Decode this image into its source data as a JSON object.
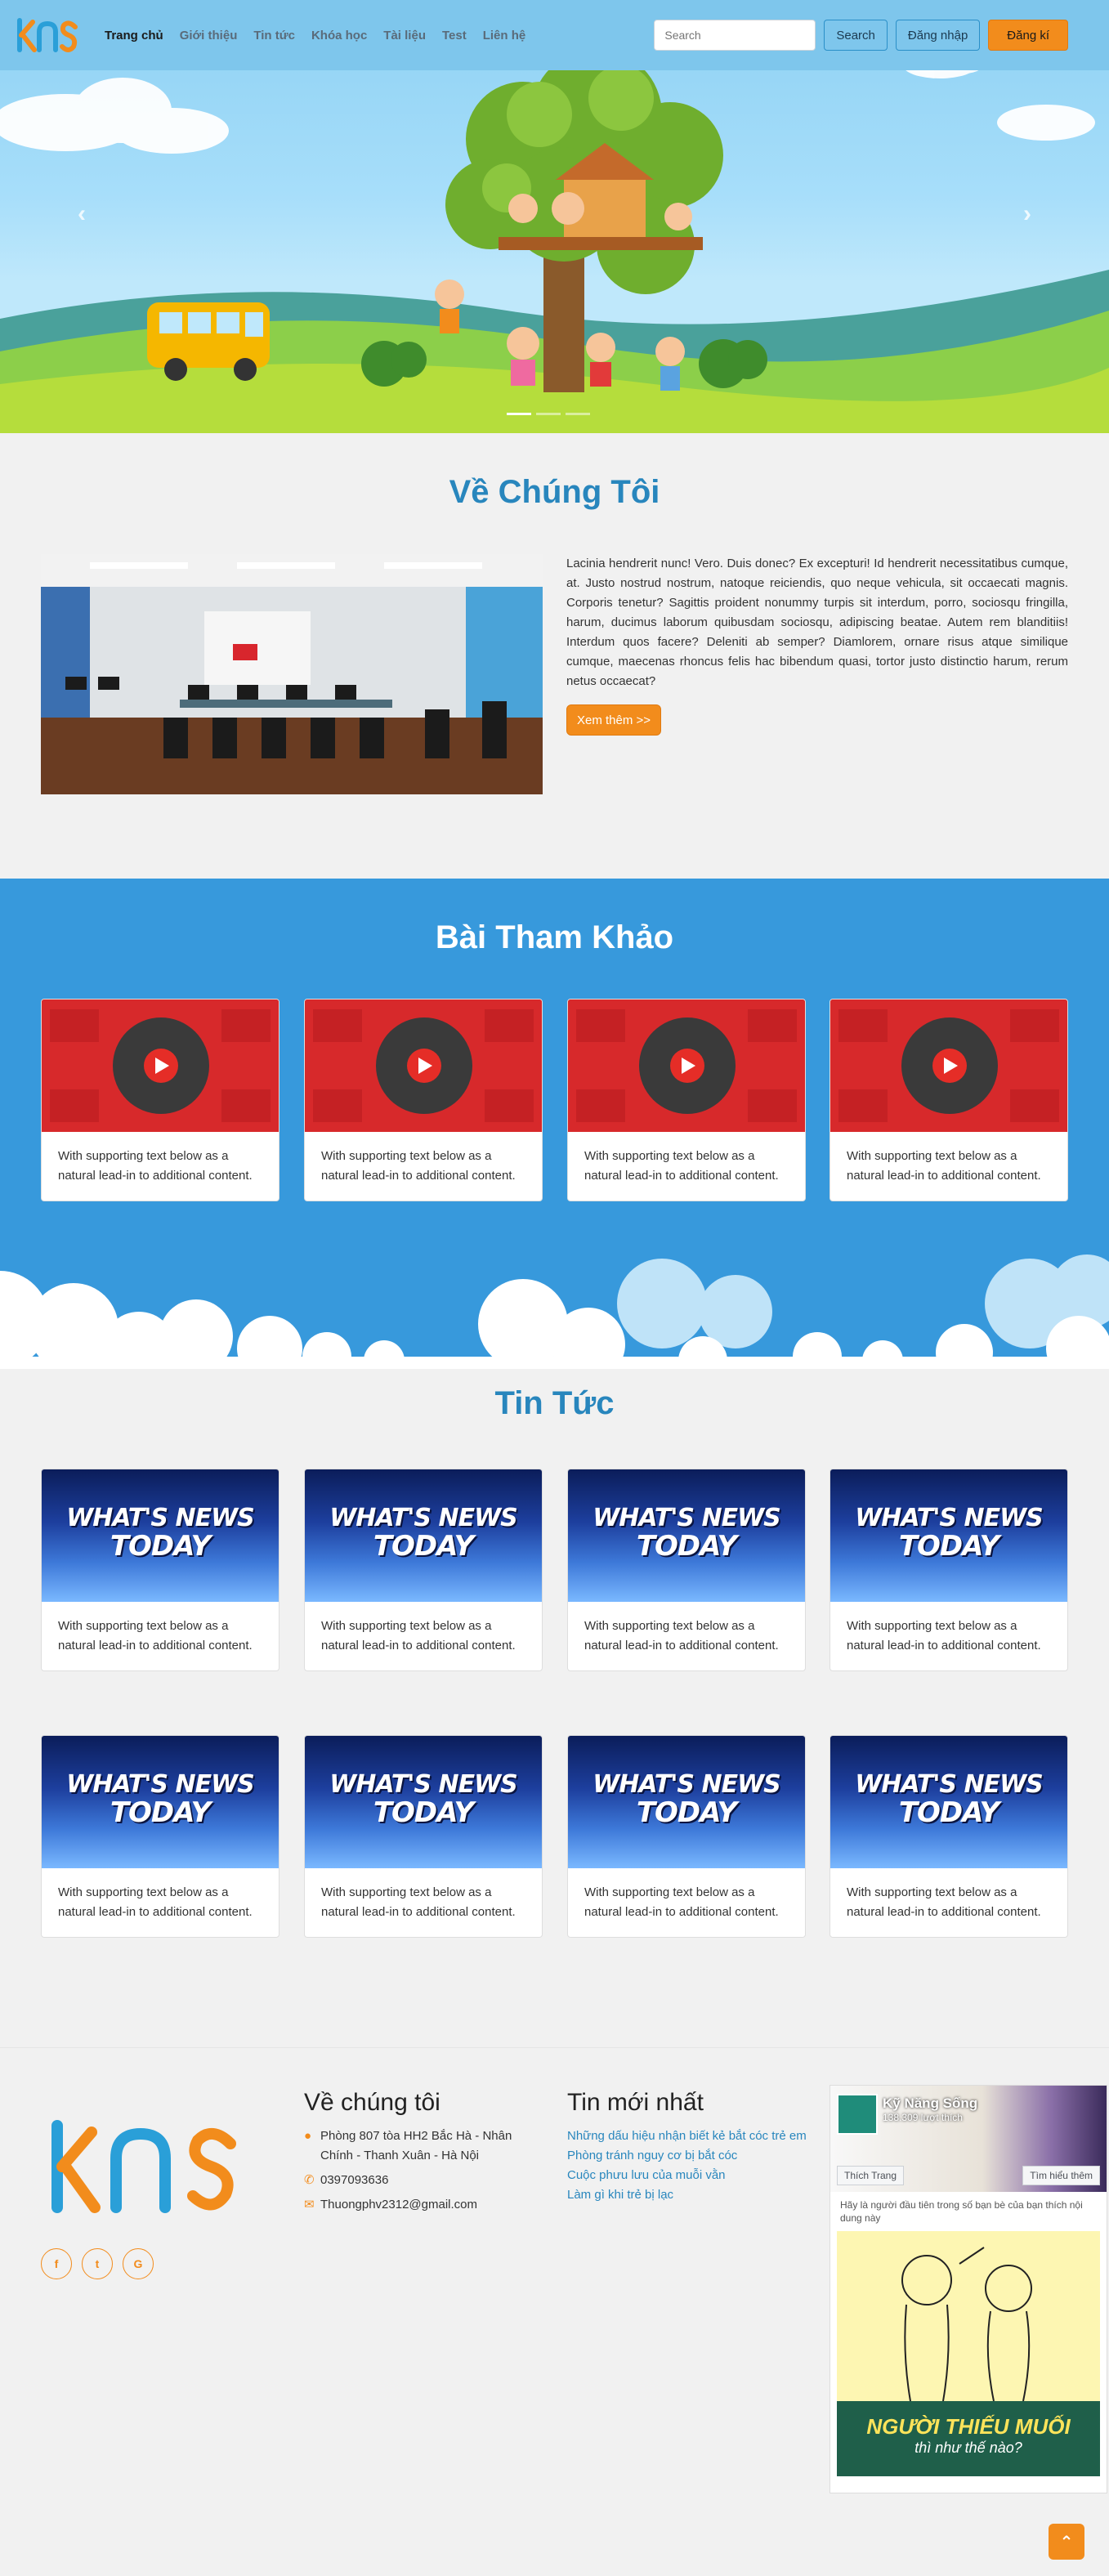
{
  "nav": {
    "logo_text": "KNS",
    "links": [
      "Trang chủ",
      "Giới thiệu",
      "Tin tức",
      "Khóa học",
      "Tài liệu",
      "Test",
      "Liên hệ"
    ],
    "search_placeholder": "Search",
    "search_button": "Search",
    "login": "Đăng nhập",
    "register": "Đăng kí"
  },
  "hero": {
    "prev": "‹",
    "next": "›"
  },
  "about": {
    "title": "Về Chúng Tôi",
    "text": "Lacinia hendrerit nunc! Vero. Duis donec? Ex excepturi! Id hendrerit necessitatibus cumque, at. Justo nostrud nostrum, natoque reiciendis, quo neque vehicula, sit occaecati magnis. Corporis tenetur? Sagittis proident nonummy turpis sit interdum, porro, sociosqu fringilla, harum, ducimus laborum quibusdam sociosqu, adipiscing beatae. Autem rem blanditiis! Interdum quos facere? Deleniti ab semper? Diamlorem, ornare risus atque similique cumque, maecenas rhoncus felis hac bibendum quasi, tortor justo distinctio harum, rerum netus occaecat?",
    "button": "Xem thêm >>"
  },
  "refs": {
    "title": "Bài Tham Khảo",
    "cards": [
      "With supporting text below as a natural lead-in to additional content.",
      "With supporting text below as a natural lead-in to additional content.",
      "With supporting text below as a natural lead-in to additional content.",
      "With supporting text below as a natural lead-in to additional content."
    ]
  },
  "news": {
    "title": "Tin Tức",
    "img_line1": "WHAT'S NEWS",
    "img_line2": "TODAY",
    "cards": [
      "With supporting text below as a natural lead-in to additional content.",
      "With supporting text below as a natural lead-in to additional content.",
      "With supporting text below as a natural lead-in to additional content.",
      "With supporting text below as a natural lead-in to additional content.",
      "With supporting text below as a natural lead-in to additional content.",
      "With supporting text below as a natural lead-in to additional content.",
      "With supporting text below as a natural lead-in to additional content.",
      "With supporting text below as a natural lead-in to additional content."
    ]
  },
  "footer": {
    "about_title": "Về chúng tôi",
    "address": "Phòng 807 tòa HH2 Bắc Hà - Nhân Chính - Thanh Xuân - Hà Nội",
    "phone": "0397093636",
    "email": "Thuongphv2312@gmail.com",
    "latest_title": "Tin mới nhất",
    "latest_links": [
      "Những dấu hiệu nhận biết kẻ bắt cóc trẻ em",
      "Phòng tránh nguy cơ bị bắt cóc",
      "Cuộc phưu lưu của muỗi vằn",
      "Làm gì khi trẻ bị lạc"
    ],
    "fb": {
      "page_name": "Kỹ Năng Sống",
      "likes": "138.309 lượt thích",
      "like_btn": "Thích Trang",
      "more_btn": "Tìm hiểu thêm",
      "post_text": "Hãy là người đầu tiên trong số bạn bè của bạn thích nội dung này",
      "banner_line1": "NGƯỜI THIẾU MUỐI",
      "banner_line2": "thì như thế nào?"
    }
  },
  "colors": {
    "accent": "#f28c1c",
    "brand_blue": "#2886bd",
    "nav_bg": "#7ec6ec",
    "refs_bg": "#3799dc"
  },
  "icons": {
    "to_top": "chevron-up-icon"
  }
}
